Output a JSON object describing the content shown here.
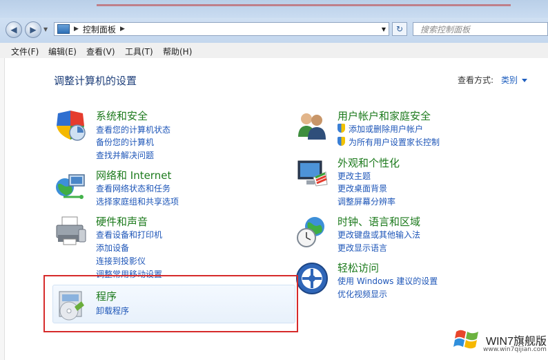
{
  "address_bar": {
    "crumb": "控制面板"
  },
  "search": {
    "placeholder": "搜索控制面板"
  },
  "menu": [
    "文件(F)",
    "编辑(E)",
    "查看(V)",
    "工具(T)",
    "帮助(H)"
  ],
  "page_title": "调整计算机的设置",
  "view_by": {
    "label": "查看方式:",
    "value": "类别"
  },
  "categories_left": [
    {
      "title": "系统和安全",
      "links": [
        "查看您的计算机状态",
        "备份您的计算机",
        "查找并解决问题"
      ],
      "icon": "shield-icon"
    },
    {
      "title": "网络和 Internet",
      "links": [
        "查看网络状态和任务",
        "选择家庭组和共享选项"
      ],
      "icon": "network-globe-icon"
    },
    {
      "title": "硬件和声音",
      "links": [
        "查看设备和打印机",
        "添加设备",
        "连接到投影仪",
        "调整常用移动设置"
      ],
      "icon": "printer-icon"
    },
    {
      "title": "程序",
      "links": [
        "卸载程序"
      ],
      "icon": "programs-cd-icon"
    }
  ],
  "categories_right": [
    {
      "title": "用户帐户和家庭安全",
      "links": [
        "添加或删除用户帐户",
        "为所有用户设置家长控制"
      ],
      "icon": "users-icon"
    },
    {
      "title": "外观和个性化",
      "links": [
        "更改主题",
        "更改桌面背景",
        "调整屏幕分辨率"
      ],
      "icon": "monitor-palette-icon"
    },
    {
      "title": "时钟、语言和区域",
      "links": [
        "更改键盘或其他输入法",
        "更改显示语言"
      ],
      "icon": "clock-globe-icon"
    },
    {
      "title": "轻松访问",
      "links": [
        "使用 Windows 建议的设置",
        "优化视频显示"
      ],
      "icon": "ease-of-access-icon"
    }
  ],
  "watermark": {
    "text": "WIN7旗舰版",
    "url": "www.win7qijian.com"
  }
}
